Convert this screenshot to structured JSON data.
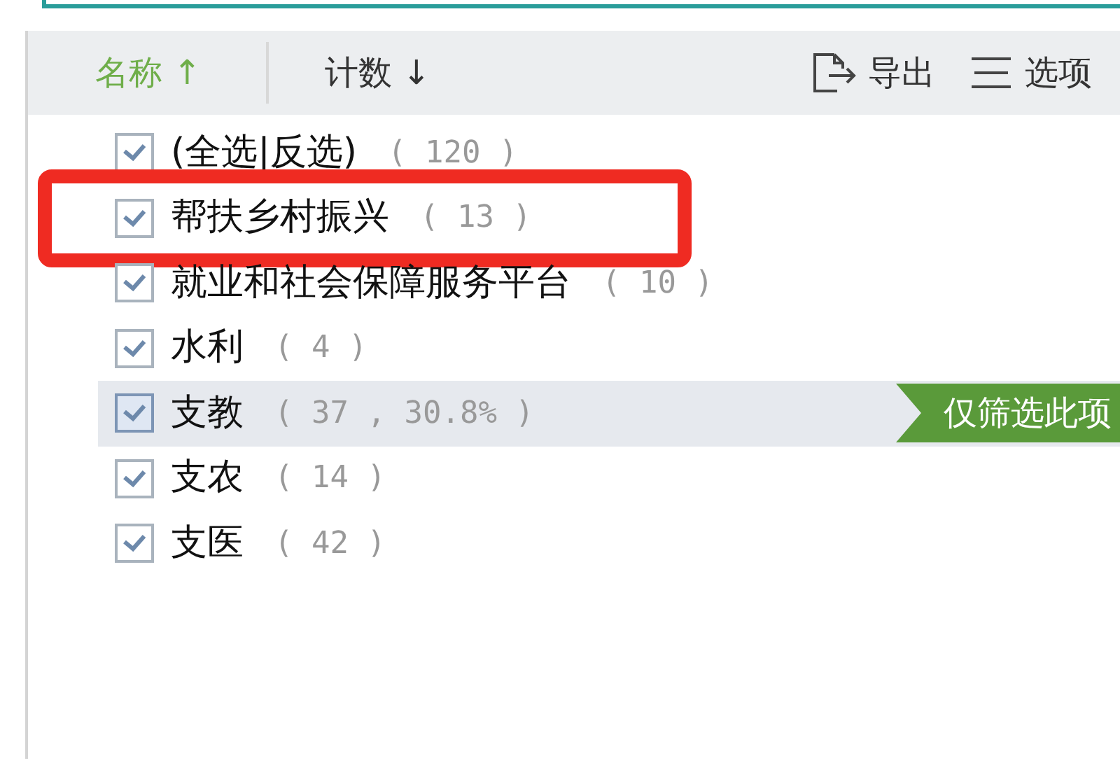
{
  "sort_headers": [
    {
      "label": "名称",
      "arrow": "↑",
      "selected": true
    },
    {
      "label": "计数",
      "arrow": "↓",
      "selected": false
    }
  ],
  "toolbar": [
    {
      "label": "导出",
      "kind": "export"
    },
    {
      "label": "选项",
      "kind": "options"
    }
  ],
  "items": [
    {
      "label": "(全选|反选)",
      "count": "( 120 )",
      "checked": true,
      "hovered": false,
      "highlighted": false
    },
    {
      "label": "帮扶乡村振兴",
      "count": "( 13 )",
      "checked": true,
      "hovered": false,
      "highlighted": true
    },
    {
      "label": "就业和社会保障服务平台",
      "count": "( 10 )",
      "checked": true,
      "hovered": false,
      "highlighted": false
    },
    {
      "label": "水利",
      "count": "( 4 )",
      "checked": true,
      "hovered": false,
      "highlighted": false
    },
    {
      "label": "支教",
      "count": "( 37 , 30.8% )",
      "checked": true,
      "hovered": true,
      "highlighted": false
    },
    {
      "label": "支农",
      "count": "( 14 )",
      "checked": true,
      "hovered": false,
      "highlighted": false
    },
    {
      "label": "支医",
      "count": "( 42 )",
      "checked": true,
      "hovered": false,
      "highlighted": false
    }
  ],
  "hover_action": "仅筛选此项"
}
